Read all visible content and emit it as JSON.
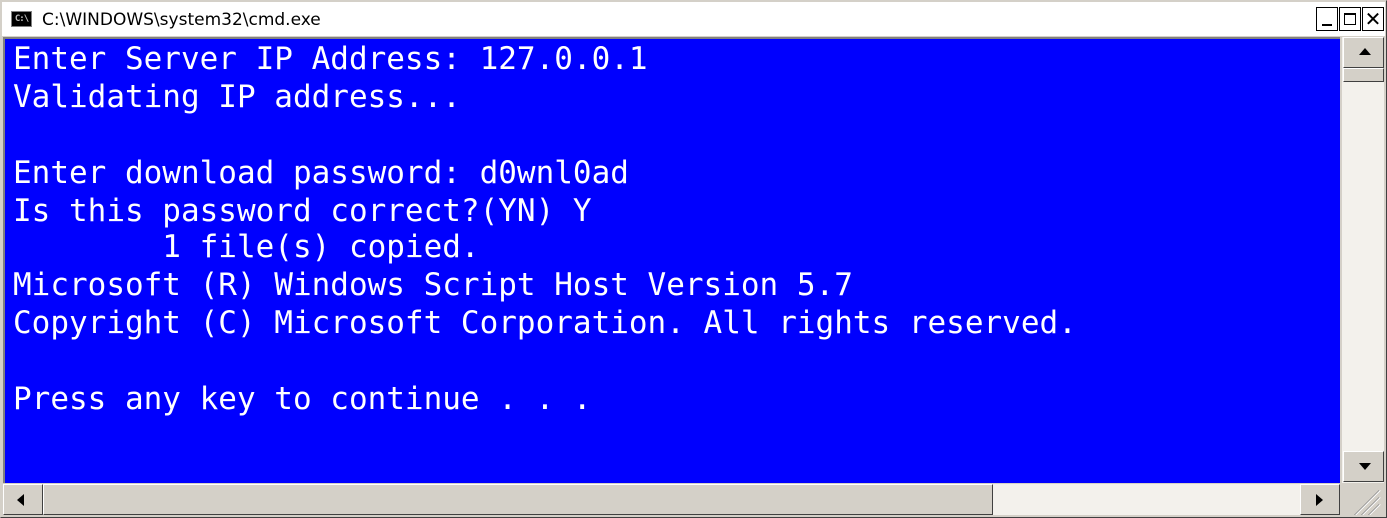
{
  "window": {
    "title": "C:\\WINDOWS\\system32\\cmd.exe",
    "app_icon_text": "C:\\",
    "caption_buttons": {
      "minimize": "minimize-icon",
      "maximize": "maximize-icon",
      "close": "✕"
    }
  },
  "console": {
    "background": "#0000fe",
    "foreground": "#ffffff",
    "lines": [
      "Enter Server IP Address: 127.0.0.1",
      "Validating IP address...",
      "",
      "Enter download password: d0wnl0ad",
      "Is this password correct?(YN) Y",
      "        1 file(s) copied.",
      "Microsoft (R) Windows Script Host Version 5.7",
      "Copyright (C) Microsoft Corporation. All rights reserved.",
      "",
      "Press any key to continue . . ."
    ]
  },
  "scrollbars": {
    "vertical": {
      "up": "arrow-up-icon",
      "down": "arrow-down-icon"
    },
    "horizontal": {
      "left": "arrow-left-icon",
      "right": "arrow-right-icon"
    }
  }
}
